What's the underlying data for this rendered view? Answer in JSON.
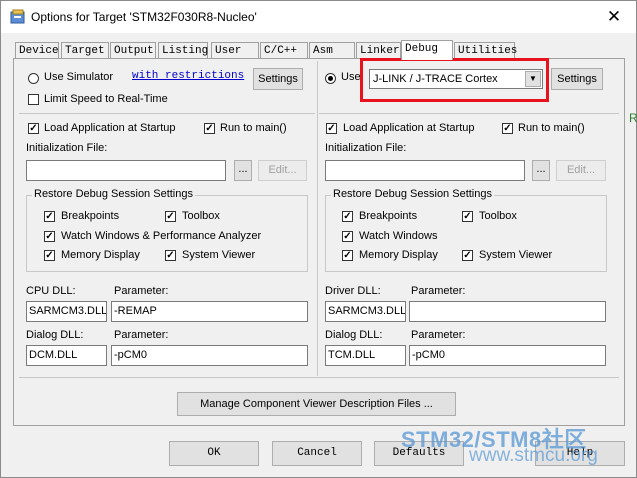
{
  "window": {
    "title": "Options for Target 'STM32F030R8-Nucleo'",
    "close_glyph": "✕"
  },
  "tabs": [
    "Device",
    "Target",
    "Output",
    "Listing",
    "User",
    "C/C++",
    "Asm",
    "Linker",
    "Debug",
    "Utilities"
  ],
  "active_tab": "Debug",
  "left": {
    "use_simulator_label": "Use Simulator",
    "restrictions_link": "with restrictions",
    "settings_label": "Settings",
    "limit_speed_label": "Limit Speed to Real-Time",
    "load_app_label": "Load Application at Startup",
    "run_to_main_label": "Run to main()",
    "init_file_label": "Initialization File:",
    "init_file_value": "",
    "browse_label": "...",
    "edit_label": "Edit...",
    "restore_group_title": "Restore Debug Session Settings",
    "breakpoints_label": "Breakpoints",
    "toolbox_label": "Toolbox",
    "watch_label": "Watch Windows & Performance Analyzer",
    "memory_label": "Memory Display",
    "system_viewer_label": "System Viewer",
    "cpu_dll_label": "CPU DLL:",
    "cpu_dll_value": "SARMCM3.DLL",
    "cpu_param_label": "Parameter:",
    "cpu_param_value": "-REMAP",
    "dialog_dll_label": "Dialog DLL:",
    "dialog_dll_value": "DCM.DLL",
    "dialog_param_label": "Parameter:",
    "dialog_param_value": "-pCM0"
  },
  "right": {
    "use_label": "Use:",
    "driver_value": "J-LINK / J-TRACE Cortex",
    "settings_label": "Settings",
    "load_app_label": "Load Application at Startup",
    "run_to_main_label": "Run to main()",
    "init_file_label": "Initialization File:",
    "init_file_value": "",
    "browse_label": "...",
    "edit_label": "Edit...",
    "restore_group_title": "Restore Debug Session Settings",
    "breakpoints_label": "Breakpoints",
    "toolbox_label": "Toolbox",
    "watch_label": "Watch Windows",
    "memory_label": "Memory Display",
    "system_viewer_label": "System Viewer",
    "driver_dll_label": "Driver DLL:",
    "driver_dll_value": "SARMCM3.DLL",
    "driver_param_label": "Parameter:",
    "driver_param_value": "",
    "dialog_dll_label": "Dialog DLL:",
    "dialog_dll_value": "TCM.DLL",
    "dialog_param_label": "Parameter:",
    "dialog_param_value": "-pCM0"
  },
  "manage_button_label": "Manage Component Viewer Description Files ...",
  "footer": {
    "ok_label": "OK",
    "cancel_label": "Cancel",
    "defaults_label": "Defaults",
    "help_label": "Help"
  },
  "checkbox_glyph": "✓",
  "dropdown_glyph": "▼",
  "watermark": {
    "line1": "STM32/STM8社区",
    "line2": "www.stmcu.org"
  },
  "side_fragment": "R",
  "colors": {
    "highlight": "#e8121d",
    "link": "#0000cc",
    "watermark": "#5797d3"
  }
}
